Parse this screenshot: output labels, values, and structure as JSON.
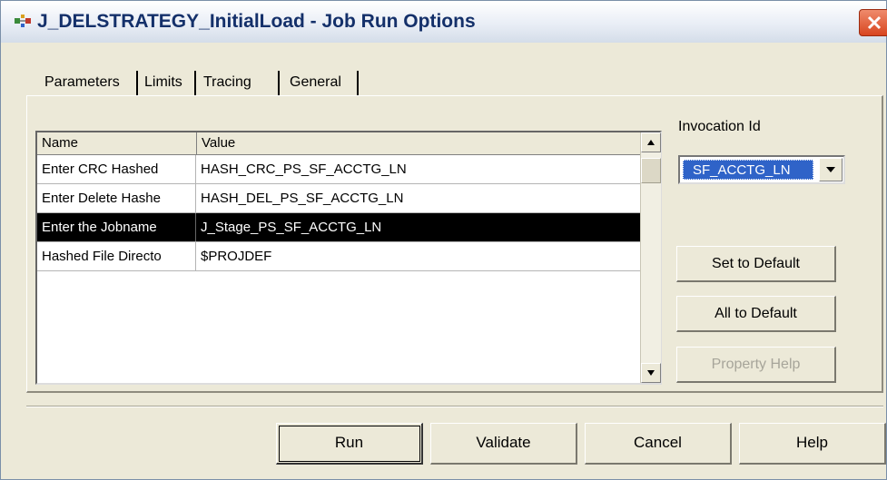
{
  "window": {
    "title": "J_DELSTRATEGY_InitialLoad - Job Run Options"
  },
  "tabs": [
    {
      "label": "Parameters"
    },
    {
      "label": "Limits"
    },
    {
      "label": "Tracing"
    },
    {
      "label": "General"
    }
  ],
  "grid": {
    "columns": [
      "Name",
      "Value"
    ],
    "rows": [
      {
        "name": "Enter CRC Hashed",
        "value": "HASH_CRC_PS_SF_ACCTG_LN"
      },
      {
        "name": "Enter Delete Hashe",
        "value": "HASH_DEL_PS_SF_ACCTG_LN"
      },
      {
        "name": "Enter the Jobname",
        "value": "J_Stage_PS_SF_ACCTG_LN",
        "selected": true
      },
      {
        "name": "Hashed File Directo",
        "value": "$PROJDEF"
      }
    ]
  },
  "invocation": {
    "label": "Invocation Id",
    "value": "SF_ACCTG_LN"
  },
  "side_buttons": {
    "set_default": "Set to Default",
    "all_default": "All to Default",
    "property_help": "Property Help"
  },
  "buttons": {
    "run": "Run",
    "validate": "Validate",
    "cancel": "Cancel",
    "help": "Help"
  },
  "colors": {
    "selection_row": "#000000",
    "combo_highlight": "#2f63c8",
    "title_text": "#14306a",
    "close_button": "#d8451f"
  },
  "icons": {
    "window": "job-run-icon",
    "close": "close-icon",
    "scroll_up": "arrow-up-icon",
    "scroll_down": "arrow-down-icon",
    "dropdown": "chevron-down-icon"
  }
}
